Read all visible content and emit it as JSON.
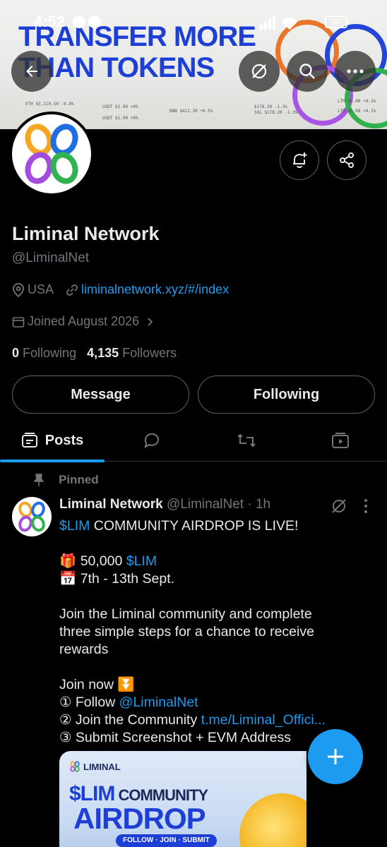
{
  "status_bar": {
    "time": "4:52",
    "battery": "40"
  },
  "banner": {
    "headline_line1": "TRANSFER MORE",
    "headline_line2": "THAN TOKENS",
    "tickers": [
      "ETH $3,210.50 -0.8%",
      "USDT $1.00 +0%",
      "BNB $412.30 +0.5%",
      "$178.20 -1.3%",
      "LTM $0.08 +4.1%",
      "USDT $1.00 +0%",
      "SOL $178.20 -1.3%",
      "LTM $0.08 +4.1%"
    ]
  },
  "profile": {
    "name": "Liminal Network",
    "handle": "@LiminalNet",
    "location": "USA",
    "website": "liminalnetwork.xyz/#/index",
    "joined": "Joined August 2026",
    "following_count": "0",
    "following_label": "Following",
    "followers_count": "4,135",
    "followers_label": "Followers"
  },
  "actions": {
    "message": "Message",
    "following": "Following"
  },
  "tabs": {
    "posts": "Posts"
  },
  "pinned_label": "Pinned",
  "post": {
    "author": "Liminal Network",
    "handle": "@LiminalNet",
    "time": "· 1h",
    "line1_tag": "$LIM",
    "line1_rest": " COMMUNITY AIRDROP IS LIVE!",
    "line2_emoji": "🎁",
    "line2_text": " 50,000 ",
    "line2_tag": "$LIM",
    "line3_emoji": "📅",
    "line3_text": " 7th - 13th Sept.",
    "para1": [
      "Join the Liminal community and complete",
      "three simple steps for a chance to receive",
      "rewards"
    ],
    "join_now": "Join now ",
    "join_emoji": "⏬",
    "step1_text": "① Follow ",
    "step1_link": "@LiminalNet",
    "step2_text": "② Join the Community ",
    "step2_link": "t.me/Liminal_Offici...",
    "step3_text": "③ Submit Screenshot + EVM Address"
  },
  "card": {
    "brand": "LIMINAL",
    "line1_tag": "$LIM",
    "line1_rest": " COMMUNITY",
    "line2": "AIRDROP",
    "line3": "FOLLOW · JOIN · SUBMIT"
  },
  "colors": {
    "accent": "#1d9bf0",
    "background": "#000000",
    "muted": "#71767b",
    "brand_blue": "#1e3fd6"
  }
}
